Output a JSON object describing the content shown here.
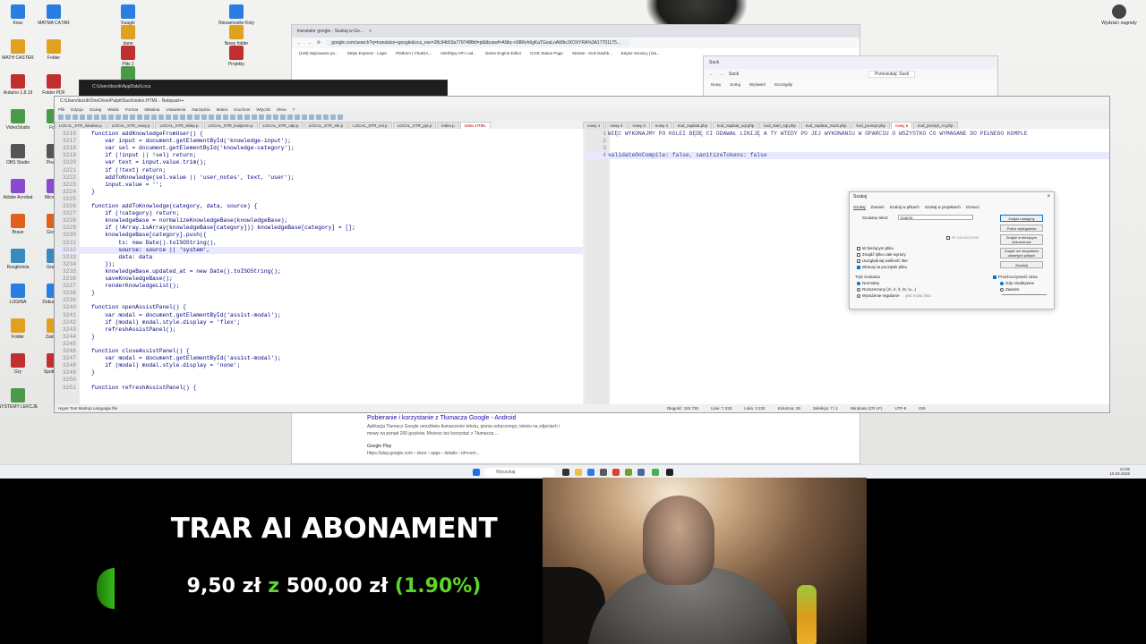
{
  "desktop": {
    "icons_left": [
      "Kosz",
      "MATH CASTER",
      "Arduino 1.8.19",
      "VideoStudio",
      "OBS Studio",
      "Adobe Acrobat",
      "Brave",
      "Rozgłośnia",
      "LOGINA",
      "Folder",
      "Gry",
      "SYSTEMY LEKCJE"
    ],
    "icons_col2": [
      "MATMA CA7AR",
      "Folder",
      "Folder PDF",
      "Foto",
      "Pisanie",
      "Microsoft",
      "Google",
      "Grafika",
      "Dokumenty",
      "Zadania",
      "Spotkania"
    ],
    "icons_col3": [
      "Kaagle",
      "dane",
      "Pliki 2",
      "Obrazy"
    ],
    "icons_col4": [
      "Niesamowite Koty",
      "Nowy folder",
      "Projekty"
    ],
    "icon_right": "Wydział i nagrody"
  },
  "browser": {
    "tab_title": "translator google - Szukaj w Go...",
    "url": "google.com/search?q=translator+google&oca_esv=28c94b53a779748fbtl=pl&tbuswf=ANbc-n98Rvh6gKaTGsaLoAWbrJXOXYRA%3A17701175...",
    "bookmarks": [
      "(148) Najnowsze po...",
      "Stripe Express - Login",
      "Platform | ChatGA...",
      "Interfejsy API i usł...",
      "Game Engine Editor",
      "ICCE Status Page",
      "Stream - Kick Dashb...",
      "Edytor stronicy | Da..."
    ],
    "result_title": "Pobieranie i korzystanie z Tłumacza Google - Android",
    "result_snippet_1": "Aplikacja Tłumacz Google umożliwia tłumaczenie tekstu, pisma odręcznego, tekstu na zdjęciach i",
    "result_snippet_2": "mowy na ponad 200 języków. Możesz też korzystać z Tłumacza ...",
    "result_source": "Google Play",
    "result_source_url": "https://play.google.com › store › apps › details › id=com..."
  },
  "explorer": {
    "tab": "Suck",
    "search_placeholder": "Przeszukaj: Suck",
    "toolbar": [
      "Nowy",
      "Sortuj",
      "Wyświetl",
      "Szczegóły"
    ]
  },
  "terminal": {
    "title": "C:\\Users\\kozik\\AppData\\Loca"
  },
  "notepad": {
    "title": "C:\\Users\\kozik\\OneDrive\\Pulpit\\Suck\\index.HTML - Notepad++",
    "menu": [
      "Plik",
      "Edycja",
      "Szukaj",
      "Widok",
      "Format",
      "Składnia",
      "Ustawienia",
      "Narzędzia",
      "Makra",
      "Uruchom",
      "Wtyczki",
      "Okna",
      "?"
    ],
    "left_tabs": [
      "LOCAL_STR_lokalnie.p",
      "LOCAL_STR_nowy.p",
      "LOCAL_STR_sklep.p",
      "LOCAL_STR_kodprom.p",
      "LOCAL_STR_odp.p",
      "LOCAL_STR_ekr.p",
      "LOCAL_STR_ost.p",
      "LOCAL_STR_pyt.p",
      "index.p",
      "index.HTML"
    ],
    "right_tabs": [
      "nowy 1",
      "nowy 2",
      "nowy 3",
      "nowy 4",
      "kod_zaplata.php",
      "kod_zaplata_sql.php",
      "kod_start_sql.php",
      "kod_zaplata_Suck.php",
      "kod_prompt.php",
      "nowy 6",
      "kod_prompt_AI.php"
    ],
    "code_lines": [
      {
        "n": "3216",
        "t": "    function addKnowledgeFromUser() {"
      },
      {
        "n": "3217",
        "t": "        var input = document.getElementById('knowledge-input');"
      },
      {
        "n": "3218",
        "t": "        var sel = document.getElementById('knowledge-category');"
      },
      {
        "n": "3219",
        "t": "        if (!input || !sel) return;"
      },
      {
        "n": "3220",
        "t": "        var text = input.value.trim();"
      },
      {
        "n": "3221",
        "t": "        if (!text) return;"
      },
      {
        "n": "3222",
        "t": "        addToKnowledge(sel.value || 'user_notes', text, 'user');"
      },
      {
        "n": "3223",
        "t": "        input.value = '';"
      },
      {
        "n": "3224",
        "t": "    }"
      },
      {
        "n": "3225",
        "t": ""
      },
      {
        "n": "3226",
        "t": "    function addToKnowledge(category, data, source) {"
      },
      {
        "n": "3227",
        "t": "        if (!category) return;"
      },
      {
        "n": "3228",
        "t": "        knowledgeBase = normalizeKnowledgeBase(knowledgeBase);"
      },
      {
        "n": "3229",
        "t": "        if (!Array.isArray(knowledgeBase[category])) knowledgeBase[category] = [];"
      },
      {
        "n": "3230",
        "t": "        knowledgeBase[category].push({"
      },
      {
        "n": "3231",
        "t": "            ts: new Date().toISOString(),"
      },
      {
        "n": "3232",
        "t": "            source: source || 'system',"
      },
      {
        "n": "3233",
        "t": "            data: data"
      },
      {
        "n": "3234",
        "t": "        });"
      },
      {
        "n": "3235",
        "t": "        knowledgeBase.updated_at = new Date().toISOString();"
      },
      {
        "n": "3236",
        "t": "        saveKnowledgeBase();"
      },
      {
        "n": "3237",
        "t": "        renderKnowledgeList();"
      },
      {
        "n": "3238",
        "t": "    }"
      },
      {
        "n": "3239",
        "t": ""
      },
      {
        "n": "3240",
        "t": "    function openAssistPanel() {"
      },
      {
        "n": "3241",
        "t": "        var modal = document.getElementById('assist-modal');"
      },
      {
        "n": "3242",
        "t": "        if (modal) modal.style.display = 'flex';"
      },
      {
        "n": "3243",
        "t": "        refreshAssistPanel();"
      },
      {
        "n": "3244",
        "t": "    }"
      },
      {
        "n": "3245",
        "t": ""
      },
      {
        "n": "3246",
        "t": "    function closeAssistPanel() {"
      },
      {
        "n": "3247",
        "t": "        var modal = document.getElementById('assist-modal');"
      },
      {
        "n": "3248",
        "t": "        if (modal) modal.style.display = 'none';"
      },
      {
        "n": "3249",
        "t": "    }"
      },
      {
        "n": "3250",
        "t": ""
      },
      {
        "n": "3251",
        "t": "    function refreshAssistPanel() {"
      }
    ],
    "right_lines": [
      {
        "n": "1",
        "t": "WIĘC WYKONAJMY PO KOLEI BĘDĘ CI ODAWAŁ LINIJĘ A TY WTEDY PO JEJ WYKONANIU W OPARCIU O WSZYSTKO CO WYMAGANE DO PEŁNEGO KOMPLE"
      },
      {
        "n": "2",
        "t": ""
      },
      {
        "n": "3",
        "t": ""
      },
      {
        "n": "4",
        "t": "validateOnCompile: false, sanitizeTokens: false"
      }
    ],
    "status_left": "Hyper Text Markup Language file",
    "status_right": [
      "Długość: 163 735",
      "Linie: 7 233",
      "Linia: 3 232",
      "Kolumna: 28",
      "Selekcja: 7 | 1",
      "Windows (CR LF)",
      "UTF-8",
      "INS"
    ]
  },
  "find_dialog": {
    "title": "Szukaj",
    "tabs": [
      "Szukaj",
      "Zamień",
      "Szukaj w plikach",
      "Szukaj w projektach",
      "Oznacz"
    ],
    "field_label": "Szukany tekst:",
    "field_value": "source",
    "buttons": [
      "Znajdź następny",
      "Policz wystąpienia",
      "Znajdź w bieżącym dokumencie",
      "Znajdź we wszystkich otwartych plikach",
      "Zamknij"
    ],
    "in_selection": "W zaznaczeniu",
    "options": [
      "W bieżącym pliku",
      "Znajdź tylko całe wyrazy",
      "Uwzględniaj wielkość liter",
      "Wracaj na początek pliku"
    ],
    "mode_label": "Tryb szukania",
    "modes": [
      "Normalny",
      "Rozszerzony (\\n, \\r, \\t, \\0, \\x...)",
      "Wyrażenie regularne"
    ],
    "mode_extra": ". jest nowa linia",
    "transparency_label": "Przeźroczystość okna",
    "transparency_opts": [
      "Gdy nieaktywne",
      "Zawsze"
    ]
  },
  "taskbar": {
    "search_placeholder": "Wyszukaj",
    "time": "12:06",
    "date": "16.02.2026"
  },
  "overlay": {
    "title": "TRAR AI ABONAMENT",
    "current": "9,50 zł",
    "separator": "z",
    "goal": "500,00 zł",
    "percent": "(1.90%)",
    "progress_fraction": 0.019,
    "colors": {
      "amount": "#ffffff",
      "separator": "#5bd62a",
      "percent": "#5bd62a"
    }
  }
}
